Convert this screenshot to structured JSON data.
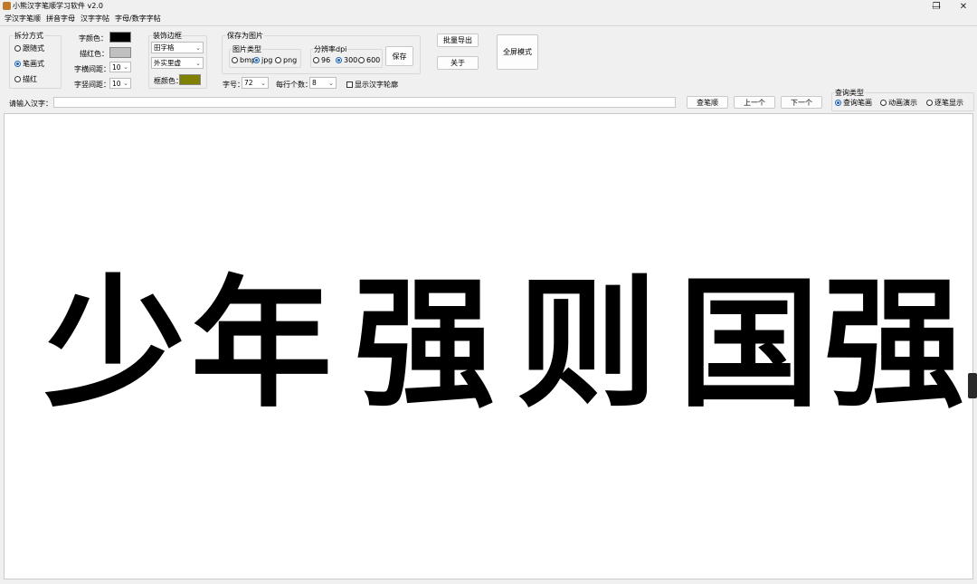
{
  "window": {
    "title": "小熊汉字笔顺学习软件 v2.0",
    "minimize": "—",
    "restore": "❐",
    "close": "✕"
  },
  "menu": [
    "学汉字笔顺",
    "拼音字母",
    "汉字字帖",
    "字母/数字字帖"
  ],
  "split_mode": {
    "title": "拆分方式",
    "options": [
      "跟随式",
      "笔画式",
      "描红"
    ],
    "selected": "笔画式"
  },
  "colors": {
    "char_color_label": "字颜色：",
    "char_color": "#000000",
    "trace_color_label": "描红色：",
    "trace_color": "#c0c0c0",
    "frame_color_label": "框颜色：",
    "frame_color": "#808000"
  },
  "spacing": {
    "h_label": "字横间距：",
    "h_value": "10",
    "v_label": "字竖间距：",
    "v_value": "10"
  },
  "border": {
    "title": "装饰边框",
    "grid_type": "田字格",
    "line_style": "外实里虚"
  },
  "save": {
    "title": "保存为图片",
    "type_title": "图片类型",
    "types": [
      "bmp",
      "jpg",
      "png"
    ],
    "type_selected": "jpg",
    "dpi_title": "分辨率dpi",
    "dpis": [
      "96",
      "300",
      "600"
    ],
    "dpi_selected": "300",
    "save_button": "保存"
  },
  "size": {
    "font_size_label": "字号：",
    "font_size": "72",
    "per_row_label": "每行个数：",
    "per_row": "8",
    "outline_label": "显示汉字轮廓"
  },
  "buttons": {
    "batch_export": "批量导出",
    "about": "关于",
    "fullscreen": "全屏模式",
    "lookup": "查笔顺",
    "prev": "上一个",
    "next": "下一个"
  },
  "input": {
    "label": "请输入汉字：",
    "value": ""
  },
  "query": {
    "title": "查询类型",
    "options": [
      "查询笔画",
      "动画演示",
      "逐笔显示"
    ],
    "selected": "查询笔画"
  },
  "display_chars": [
    "少",
    "年",
    "强",
    "则",
    "国",
    "强"
  ]
}
